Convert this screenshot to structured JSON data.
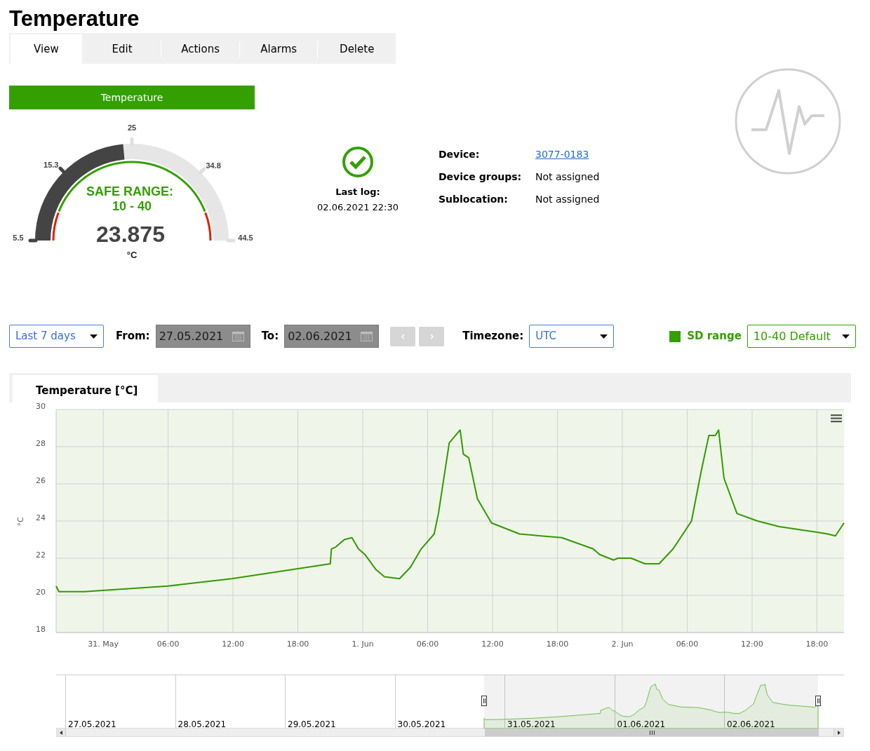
{
  "title": "Temperature",
  "tabs": [
    {
      "label": "View",
      "selected": true
    },
    {
      "label": "Edit",
      "selected": false
    },
    {
      "label": "Actions",
      "selected": false
    },
    {
      "label": "Alarms",
      "selected": false
    },
    {
      "label": "Delete",
      "selected": false
    }
  ],
  "sensor_button": "Temperature",
  "gauge": {
    "ticks": [
      "5.5",
      "15.3",
      "25",
      "34.8",
      "44.5"
    ],
    "safe_range_label": "SAFE RANGE:",
    "safe_range": "10 - 40",
    "value": "23.875",
    "unit": "°C",
    "level": 0.471
  },
  "status": {
    "label": "Last log:",
    "time": "02.06.2021 22:30"
  },
  "details": [
    {
      "label": "Device:",
      "value": "3077-0183",
      "kind": "link"
    },
    {
      "label": "Device groups:",
      "value": "Not assigned",
      "kind": "text"
    },
    {
      "label": "Sublocation:",
      "value": "Not assigned",
      "kind": "text"
    }
  ],
  "filters": {
    "period": "Last 7 days",
    "from_label": "From:",
    "from": "27.05.2021",
    "to_label": "To:",
    "to": "02.06.2021",
    "timezone_label": "Timezone:",
    "timezone": "UTC",
    "sd_range_label": "SD range",
    "sd_range": "10-40 Default"
  },
  "chart_tabs": [
    {
      "label": "Temperature [°C]",
      "selected": true
    }
  ],
  "chart": {
    "chart_data": {
      "type": "line",
      "ylabel": "°C",
      "x": [
        "2021-05-30T19:39",
        "2021-05-30T19:54",
        "2021-05-30T22:15",
        "2021-05-31T06:00",
        "2021-05-31T11:54",
        "2021-05-31T21:00",
        "2021-05-31T21:06",
        "2021-05-31T21:30",
        "2021-05-31T22:18",
        "2021-05-31T23:00",
        "2021-05-31T23:36",
        "2021-06-01T00:12",
        "2021-06-01T01:12",
        "2021-06-01T02:00",
        "2021-06-01T03:24",
        "2021-06-01T04:24",
        "2021-06-01T05:24",
        "2021-06-01T06:36",
        "2021-06-01T07:00",
        "2021-06-01T08:00",
        "2021-06-01T09:00",
        "2021-06-01T09:18",
        "2021-06-01T09:48",
        "2021-06-01T10:36",
        "2021-06-01T11:54",
        "2021-06-01T14:30",
        "2021-06-01T18:24",
        "2021-06-01T21:18",
        "2021-06-01T21:54",
        "2021-06-01T23:12",
        "2021-06-01T23:36",
        "2021-06-02T00:48",
        "2021-06-02T02:06",
        "2021-06-02T03:24",
        "2021-06-02T04:42",
        "2021-06-02T06:24",
        "2021-06-02T07:18",
        "2021-06-02T08:00",
        "2021-06-02T08:36",
        "2021-06-02T08:54",
        "2021-06-02T09:24",
        "2021-06-02T10:36",
        "2021-06-02T12:30",
        "2021-06-02T14:30",
        "2021-06-02T18:00",
        "2021-06-02T19:00",
        "2021-06-02T19:42",
        "2021-06-02T20:30"
      ],
      "grid": true,
      "series": [
        {
          "color": "#339900",
          "values": [
            20.5,
            20.2,
            20.2,
            20.5,
            20.9,
            21.7,
            22.5,
            22.6,
            23.0,
            23.1,
            22.5,
            22.2,
            21.4,
            21.0,
            20.9,
            21.5,
            22.5,
            23.3,
            24.4,
            28.2,
            28.9,
            27.6,
            27.4,
            25.2,
            23.9,
            23.3,
            23.1,
            22.5,
            22.2,
            21.9,
            22.0,
            22.0,
            21.7,
            21.7,
            22.5,
            24.0,
            26.7,
            28.6,
            28.6,
            28.9,
            26.3,
            24.4,
            24.0,
            23.7,
            23.4,
            23.3,
            23.2,
            23.9
          ]
        }
      ],
      "xlim": [
        "2021-05-30T19:39",
        "2021-06-02T20:30"
      ],
      "ylim": [
        18,
        30
      ],
      "xticks": [
        {
          "value": "2021-05-31T00:00",
          "label": "31. May"
        },
        {
          "value": "2021-05-31T06:00",
          "label": "06:00"
        },
        {
          "value": "2021-05-31T12:00",
          "label": "12:00"
        },
        {
          "value": "2021-05-31T18:00",
          "label": "18:00"
        },
        {
          "value": "2021-06-01T00:00",
          "label": "1. Jun"
        },
        {
          "value": "2021-06-01T06:00",
          "label": "06:00"
        },
        {
          "value": "2021-06-01T12:00",
          "label": "12:00"
        },
        {
          "value": "2021-06-01T18:00",
          "label": "18:00"
        },
        {
          "value": "2021-06-02T00:00",
          "label": "2. Jun"
        },
        {
          "value": "2021-06-02T06:00",
          "label": "06:00"
        },
        {
          "value": "2021-06-02T12:00",
          "label": "12:00"
        },
        {
          "value": "2021-06-02T18:00",
          "label": "18:00"
        }
      ],
      "yticks": [
        18,
        20,
        22,
        24,
        26,
        28,
        30
      ]
    }
  },
  "navigator": {
    "dates": [
      "27.05.2021",
      "28.05.2021",
      "29.05.2021",
      "30.05.2021",
      "31.05.2021",
      "01.06.2021",
      "02.06.2021"
    ]
  }
}
